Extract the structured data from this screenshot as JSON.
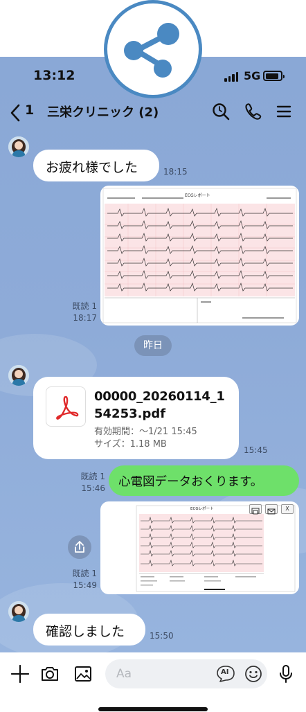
{
  "status_bar": {
    "time": "13:12",
    "network": "5G"
  },
  "header": {
    "back_count": "1",
    "title": "三栄クリニック (2)"
  },
  "icons": {
    "share": "share-icon",
    "back": "chevron-left-icon",
    "search": "search-icon",
    "call": "phone-icon",
    "menu": "hamburger-menu-icon",
    "pdf": "adobe-pdf-icon",
    "upload": "share-upload-icon",
    "add": "plus-icon",
    "camera": "camera-icon",
    "gallery": "image-icon",
    "ai": "ai-icon",
    "emoji": "emoji-icon",
    "mic": "microphone-icon"
  },
  "messages": {
    "m1": {
      "text": "お疲れ様でした",
      "time": "18:15"
    },
    "m2": {
      "read": "既読 1",
      "time": "18:17",
      "image_title": "ECGレポート"
    },
    "date_divider": "昨日",
    "m3": {
      "file_name_line1": "00000_20260114_1",
      "file_name_line2": "54253.pdf",
      "expiry": "有効期間：～1/21 15:45",
      "size": "サイズ：1.18 MB",
      "time": "15:45"
    },
    "m4": {
      "text": "心電図データおくります。",
      "read": "既読 1",
      "time": "15:46"
    },
    "m5": {
      "read": "既読 1",
      "time": "15:49",
      "image_title": "ECGレポート",
      "close_label": "X"
    },
    "m6": {
      "text": "確認しました",
      "time": "15:50"
    }
  },
  "composer": {
    "placeholder": "Aa",
    "ai_label": "AI"
  },
  "colors": {
    "chat_bg": "#8eabd8",
    "sent_bubble": "#6ee06a",
    "badge_ring": "#4a89c2",
    "pdf_red": "#e0292a"
  }
}
